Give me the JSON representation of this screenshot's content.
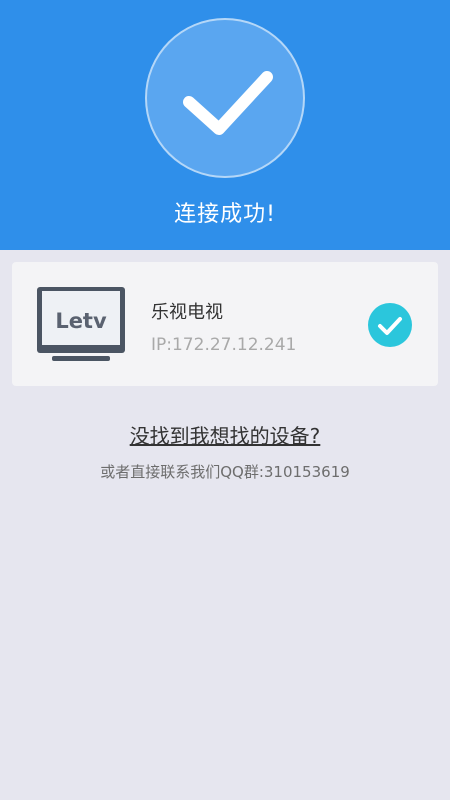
{
  "header": {
    "status_title": "连接成功!",
    "accent_color": "#2f8fea",
    "icon": "checkmark-icon"
  },
  "device": {
    "brand_logo": "Letv",
    "name": "乐视电视",
    "ip": "IP:172.27.12.241",
    "icon": "tv-icon",
    "selected_icon": "check-circle-icon",
    "selected_color": "#2bc6dc"
  },
  "help": {
    "link_text": "没找到我想找的设备?",
    "contact_text": "或者直接联系我们QQ群:310153619"
  }
}
